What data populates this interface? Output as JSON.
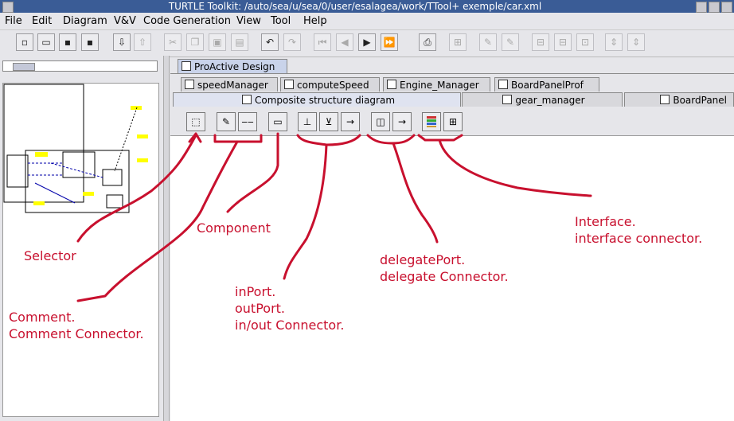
{
  "window": {
    "title": "TURTLE Toolkit: /auto/sea/u/sea/0/user/esalagea/work/TTool+ exemple/car.xml"
  },
  "menubar": [
    "File",
    "Edit",
    "Diagram",
    "V&V",
    "Code Generation",
    "View",
    "Tool",
    "Help"
  ],
  "tabs": {
    "top": [
      "ProActive Design"
    ],
    "components": [
      "speedManager",
      "computeSpeed",
      "Engine_Manager",
      "BoardPanelProf"
    ],
    "diagrams": [
      "Composite structure diagram",
      "gear_manager",
      "BoardPanel"
    ]
  },
  "annotations": {
    "selector": "Selector",
    "component": "Component",
    "comment": [
      "Comment.",
      "Comment Connector."
    ],
    "ports": [
      "inPort.",
      "outPort.",
      "in/out Connector."
    ],
    "delegate": [
      "delegatePort.",
      "delegate Connector."
    ],
    "interface": [
      "Interface.",
      "interface connector."
    ]
  }
}
